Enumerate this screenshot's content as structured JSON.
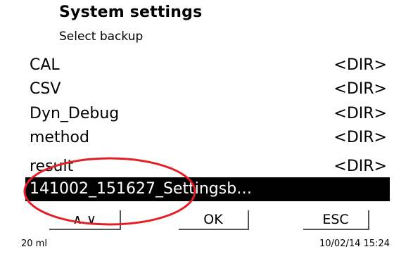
{
  "header": {
    "title": "System settings",
    "subtitle": "Select backup"
  },
  "file_list": {
    "items": [
      {
        "name": "CAL",
        "type": "<DIR>"
      },
      {
        "name": "CSV",
        "type": "<DIR>"
      },
      {
        "name": "Dyn_Debug",
        "type": "<DIR>"
      },
      {
        "name": "method",
        "type": "<DIR>"
      },
      {
        "name": "result",
        "type": "<DIR>"
      },
      {
        "name": "141002_151627_Settingsb…",
        "type": "",
        "selected": true
      }
    ]
  },
  "softkeys": {
    "updown": "∧ ∨",
    "ok": "OK",
    "esc": "ESC"
  },
  "status_bar": {
    "volume": "20 ml",
    "datetime": "10/02/14 15:24"
  },
  "colors": {
    "selection_bg": "#000000",
    "annotation_circle": "#e31e24"
  }
}
